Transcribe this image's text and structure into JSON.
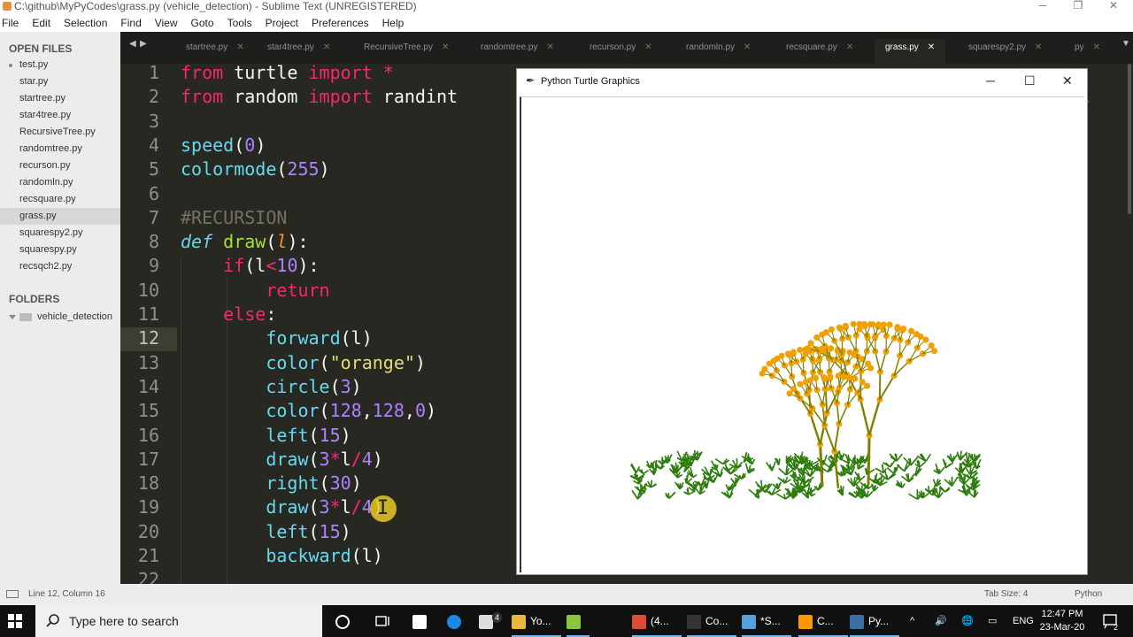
{
  "window": {
    "title": "C:\\github\\MyPyCodes\\grass.py (vehicle_detection) - Sublime Text (UNREGISTERED)",
    "minimize": "─",
    "maximize": "❐",
    "close": "✕"
  },
  "menu": [
    "File",
    "Edit",
    "Selection",
    "Find",
    "View",
    "Goto",
    "Tools",
    "Project",
    "Preferences",
    "Help"
  ],
  "sidebar": {
    "open_files_header": "OPEN FILES",
    "open_files": [
      "test.py",
      "star.py",
      "startree.py",
      "star4tree.py",
      "RecursiveTree.py",
      "randomtree.py",
      "recurson.py",
      "randomln.py",
      "recsquare.py",
      "grass.py",
      "squarespy2.py",
      "squarespy.py",
      "recsqch2.py"
    ],
    "active_file_index": 9,
    "folders_header": "FOLDERS",
    "folder": "vehicle_detection"
  },
  "tabs": {
    "items": [
      "startree.py",
      "star4tree.py",
      "RecursiveTree.py",
      "randomtree.py",
      "recurson.py",
      "randomln.py",
      "recsquare.py",
      "grass.py",
      "squarespy2.py",
      "py"
    ],
    "active_index": 7,
    "close_glyph": "✕",
    "nav_prev": "◀",
    "nav_next": "▶",
    "overflow": "▼"
  },
  "editor": {
    "line_numbers": [
      1,
      2,
      3,
      4,
      5,
      6,
      7,
      8,
      9,
      10,
      11,
      12,
      13,
      14,
      15,
      16,
      17,
      18,
      19,
      20,
      21,
      22
    ],
    "current_line": 12,
    "lines": [
      "from turtle import *",
      "from random import randint",
      "",
      "speed(0)",
      "colormode(255)",
      "",
      "#RECURSION",
      "def draw(l):",
      "    if(l<10):",
      "        return",
      "    else:",
      "        forward(l)",
      "        color(\"orange\")",
      "        circle(3)",
      "        color(128,128,0)",
      "        left(15)",
      "        draw(3*l/4)",
      "        right(30)",
      "        draw(3*l/4)",
      "        left(15)",
      "        backward(l)",
      ""
    ]
  },
  "turtle_window": {
    "title": "Python Turtle Graphics",
    "minimize": "─",
    "maximize": "☐",
    "close": "✕",
    "colors": {
      "grass": "#2e7d0e",
      "trunk": "#808000",
      "blossom": "#f0a000"
    }
  },
  "statusbar": {
    "position": "Line 12, Column 16",
    "tab_size": "Tab Size: 4",
    "syntax": "Python"
  },
  "taskbar": {
    "search_placeholder": "Type here to search",
    "items": [
      {
        "label": "Yo...",
        "icon": "folder-icon",
        "color": "#e8b83a"
      },
      {
        "label": "",
        "icon": "lambda-icon",
        "color": "#8cc63f"
      },
      {
        "label": "(4...",
        "icon": "chrome-icon",
        "color": "#dd4b39"
      },
      {
        "label": "Co...",
        "icon": "terminal-icon",
        "color": "#333333"
      },
      {
        "label": "*S...",
        "icon": "notepad-icon",
        "color": "#5aa0d8"
      },
      {
        "label": "C...",
        "icon": "sublime-icon",
        "color": "#ff9800"
      },
      {
        "label": "Py...",
        "icon": "python-icon",
        "color": "#3b6ea5"
      }
    ],
    "mail_badge": "4",
    "language": "ENG",
    "time": "12:47 PM",
    "date": "23-Mar-20",
    "notification_badge": "2"
  }
}
